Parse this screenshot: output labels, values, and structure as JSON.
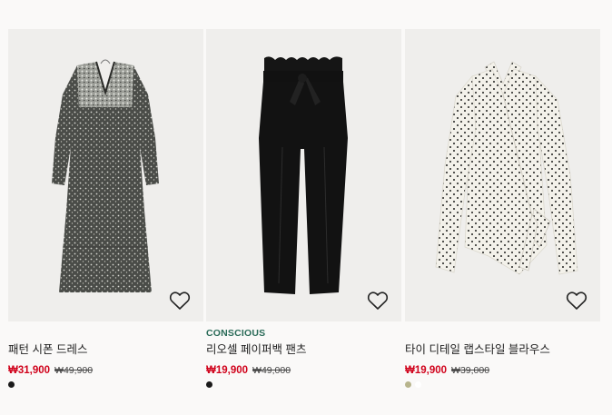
{
  "products": [
    {
      "name": "패턴 시폰 드레스",
      "tag": "",
      "sale_price": "₩31,900",
      "original_price": "₩49,900",
      "swatches": [
        "#1a1a1a"
      ],
      "image_icon": "patterned-chiffon-dress",
      "favorite_icon": "heart-outline-icon"
    },
    {
      "name": "리오셀 페이퍼백 팬츠",
      "tag": "CONSCIOUS",
      "sale_price": "₩19,900",
      "original_price": "₩49,000",
      "swatches": [
        "#1a1a1a"
      ],
      "image_icon": "black-paperbag-pants",
      "favorite_icon": "heart-outline-icon"
    },
    {
      "name": "타이 디테일 랩스타일 블라우스",
      "tag": "",
      "sale_price": "₩19,900",
      "original_price": "₩39,000",
      "swatches": [
        "#b7b48c",
        "#ffffff"
      ],
      "image_icon": "polka-dot-wrap-blouse",
      "favorite_icon": "heart-outline-icon"
    }
  ],
  "colors": {
    "background": "#faf9f8",
    "image_background": "#efeeec",
    "sale": "#d0021b",
    "conscious_tag": "#2a6b58"
  }
}
